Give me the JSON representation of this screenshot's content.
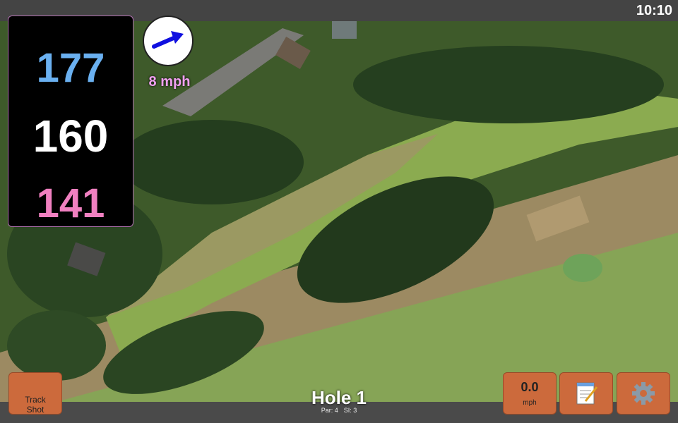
{
  "status": {
    "time": "10:10"
  },
  "distances": {
    "back": "177",
    "middle": "160",
    "front": "141"
  },
  "wind": {
    "speed_label": "8 mph",
    "direction": "east-northeast"
  },
  "buttons": {
    "track_shot": "Track\nShot",
    "wind_value": "0.0",
    "wind_unit": "mph",
    "notes_icon": "notepad-icon",
    "settings_icon": "gear-icon"
  },
  "hole": {
    "title": "Hole 1",
    "par": "Par: 4",
    "si": "SI: 3"
  },
  "colors": {
    "button": "#cc6a3c",
    "back_distance": "#6ab0f0",
    "middle_distance": "#ffffff",
    "front_distance": "#f080c0",
    "wind_label": "#f0a0f0"
  }
}
